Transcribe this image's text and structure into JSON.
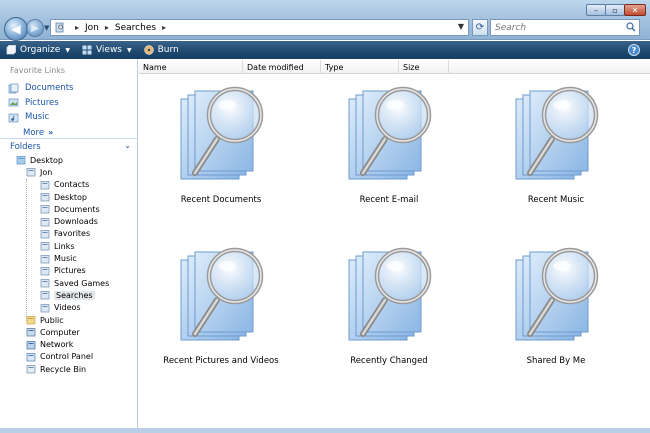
{
  "address": {
    "path": [
      "Jon",
      "Searches"
    ]
  },
  "search": {
    "placeholder": "Search"
  },
  "toolbar": {
    "organize": "Organize",
    "views": "Views",
    "burn": "Burn"
  },
  "nav": {
    "favorites_header": "Favorite Links",
    "favorites": [
      {
        "label": "Documents",
        "icon": "documents-icon"
      },
      {
        "label": "Pictures",
        "icon": "pictures-icon"
      },
      {
        "label": "Music",
        "icon": "music-icon"
      }
    ],
    "more": "More",
    "folders_header": "Folders",
    "tree": [
      {
        "label": "Desktop",
        "level": 0
      },
      {
        "label": "Jon",
        "level": 1
      },
      {
        "label": "Contacts",
        "level": 2
      },
      {
        "label": "Desktop",
        "level": 2
      },
      {
        "label": "Documents",
        "level": 2
      },
      {
        "label": "Downloads",
        "level": 2
      },
      {
        "label": "Favorites",
        "level": 2
      },
      {
        "label": "Links",
        "level": 2
      },
      {
        "label": "Music",
        "level": 2
      },
      {
        "label": "Pictures",
        "level": 2
      },
      {
        "label": "Saved Games",
        "level": 2
      },
      {
        "label": "Searches",
        "level": 2,
        "selected": true
      },
      {
        "label": "Videos",
        "level": 2
      },
      {
        "label": "Public",
        "level": 1
      },
      {
        "label": "Computer",
        "level": 1
      },
      {
        "label": "Network",
        "level": 1
      },
      {
        "label": "Control Panel",
        "level": 1
      },
      {
        "label": "Recycle Bin",
        "level": 1
      }
    ]
  },
  "columns": [
    "Name",
    "Date modified",
    "Type",
    "Size"
  ],
  "items": [
    "Recent Documents",
    "Recent E-mail",
    "Recent Music",
    "Recent Pictures and Videos",
    "Recently Changed",
    "Shared By Me"
  ],
  "colors": {
    "toolbar": "#1f4a71",
    "link": "#1a56a8",
    "selection": "#e4e7ea"
  }
}
